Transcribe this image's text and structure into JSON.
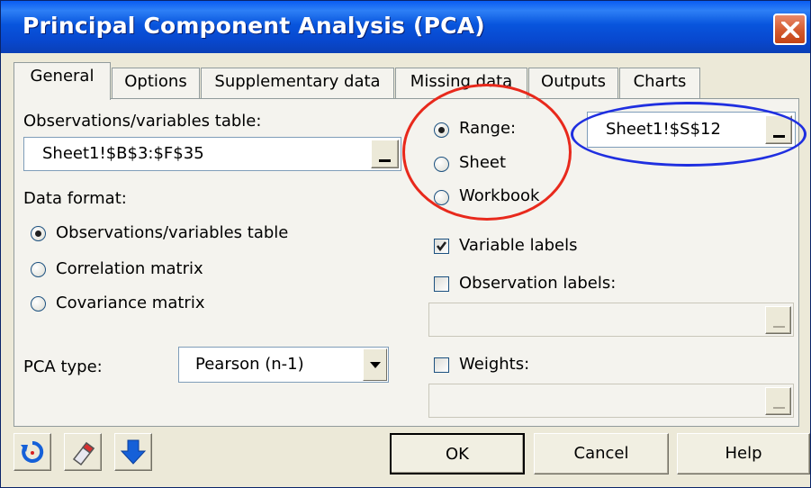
{
  "window": {
    "title": "Principal Component Analysis (PCA)"
  },
  "tabs": [
    {
      "label": "General",
      "active": true
    },
    {
      "label": "Options",
      "active": false
    },
    {
      "label": "Supplementary data",
      "active": false
    },
    {
      "label": "Missing data",
      "active": false
    },
    {
      "label": "Outputs",
      "active": false
    },
    {
      "label": "Charts",
      "active": false
    }
  ],
  "general": {
    "obs_vars_label": "Observations/variables table:",
    "obs_vars_value": "Sheet1!$B$3:$F$35",
    "data_format_label": "Data format:",
    "data_format_options": [
      {
        "label": "Observations/variables table",
        "selected": true
      },
      {
        "label": "Correlation matrix",
        "selected": false
      },
      {
        "label": "Covariance matrix",
        "selected": false
      }
    ],
    "pca_type_label": "PCA type:",
    "pca_type_value": "Pearson (n-1)",
    "location_options": [
      {
        "label": "Range:",
        "selected": true
      },
      {
        "label": "Sheet",
        "selected": false
      },
      {
        "label": "Workbook",
        "selected": false
      }
    ],
    "range_value": "Sheet1!$S$12",
    "variable_labels": {
      "label": "Variable labels",
      "checked": true
    },
    "observation_labels": {
      "label": "Observation labels:",
      "checked": false,
      "value": ""
    },
    "weights": {
      "label": "Weights:",
      "checked": false,
      "value": ""
    }
  },
  "footer": {
    "icons": [
      "reset-icon",
      "eraser-icon",
      "down-arrow-icon"
    ],
    "ok_label": "OK",
    "cancel_label": "Cancel",
    "help_label": "Help"
  },
  "annotations": {
    "red_ellipse_color": "#E8291C",
    "blue_ellipse_color": "#1F2FE0"
  },
  "colors": {
    "title_bar": "#0A5CF2",
    "dialog_bg": "#ECE9D8",
    "close_button": "#D45A2F",
    "arrow_icon": "#1560D8"
  }
}
